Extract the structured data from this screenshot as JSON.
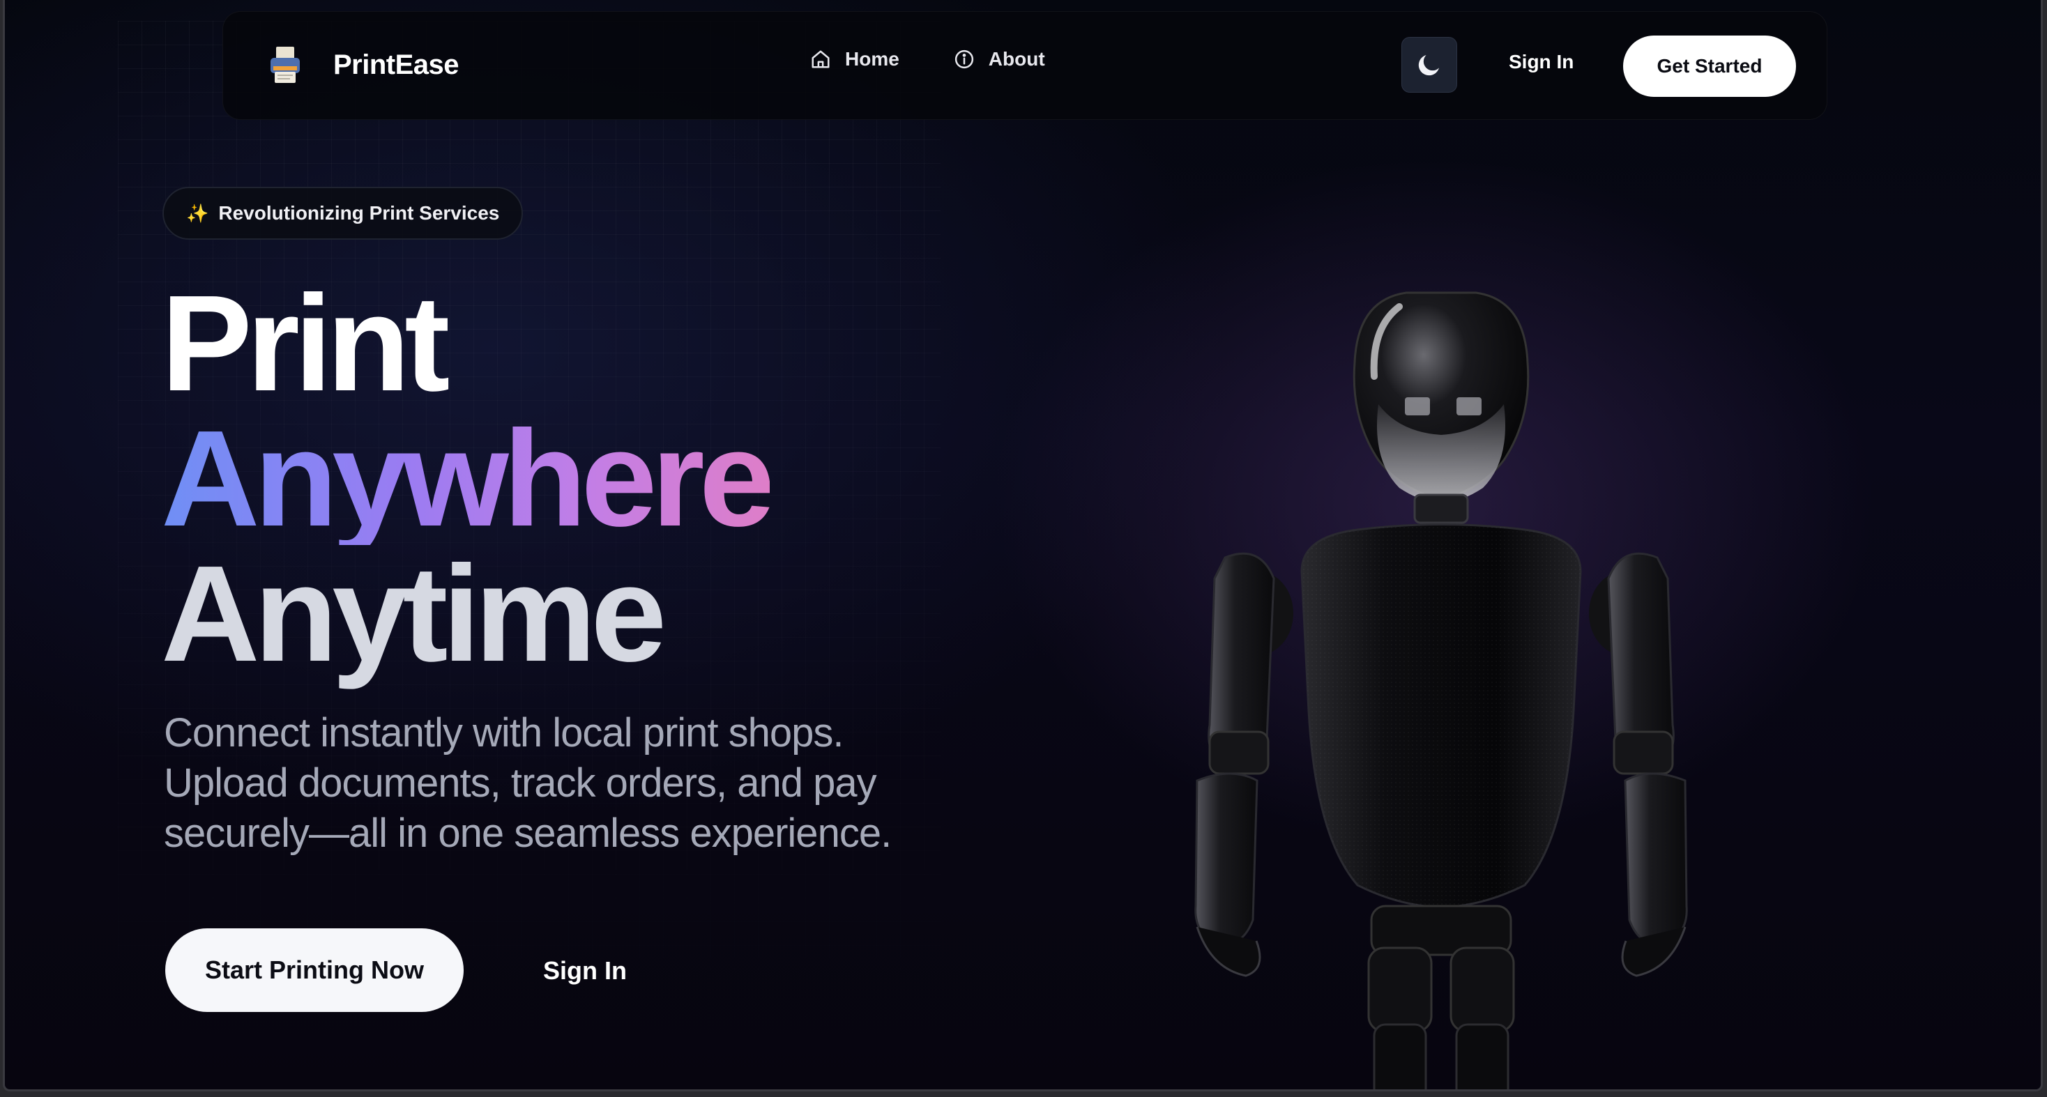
{
  "brand": {
    "name": "PrintEase",
    "icon": "printer-icon"
  },
  "nav": {
    "links": [
      {
        "label": "Home",
        "icon": "home-icon"
      },
      {
        "label": "About",
        "icon": "info-icon"
      }
    ],
    "theme_toggle_icon": "moon-icon",
    "sign_in_label": "Sign In",
    "get_started_label": "Get Started"
  },
  "hero": {
    "badge_icon": "sparkles-icon",
    "badge_label": "Revolutionizing Print Services",
    "title_line1": "Print",
    "title_line2": "Anywhere",
    "title_line3": "Anytime",
    "description": "Connect instantly with local print shops. Upload documents, track orders, and pay securely—all in one seamless experience.",
    "primary_cta": "Start Printing Now",
    "secondary_cta": "Sign In",
    "illustration": "robot-3d-render"
  },
  "colors": {
    "background": "#07080f",
    "gradient_start": "#6f8ff5",
    "gradient_end": "#de7ec8",
    "button_bg": "#ffffff",
    "toggle_bg": "#1c2230"
  }
}
